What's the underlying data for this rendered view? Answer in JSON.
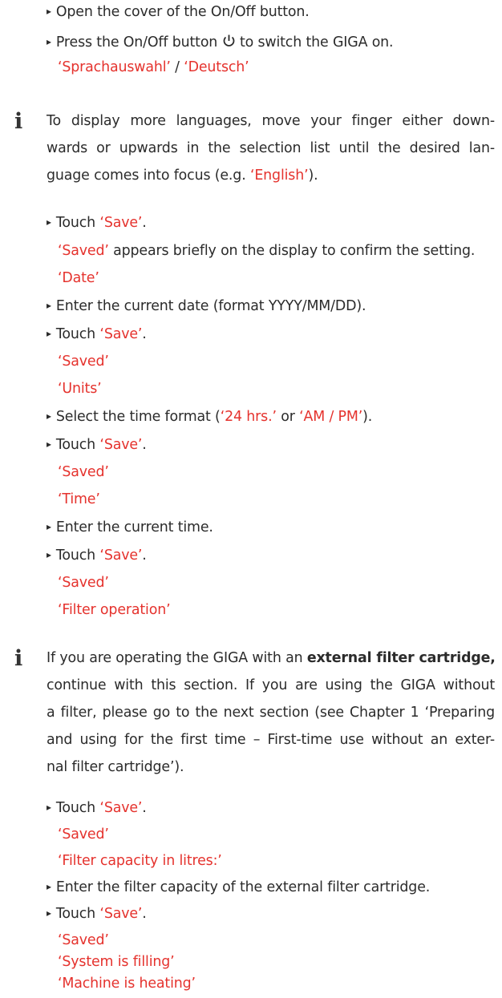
{
  "steps": [
    {
      "text": "Open the cover of the On/Off button."
    },
    {
      "pre": "Press the On/Off button ",
      "post": " to switch the GIGA on."
    },
    {
      "pre": "Touch ",
      "hl": "Save",
      "post": "."
    },
    {
      "text": "Enter the current date (format YYYY/MM/DD)."
    },
    {
      "pre": "Touch ",
      "hl": "Save",
      "post": "."
    },
    {
      "pre": "Select the time format (",
      "hl": "24 hrs.",
      "mid": " or ",
      "hl2": "AM / PM",
      "post": ")."
    },
    {
      "pre": "Touch ",
      "hl": "Save",
      "post": "."
    },
    {
      "text": "Enter the current time."
    },
    {
      "pre": "Touch ",
      "hl": "Save",
      "post": "."
    },
    {
      "pre": "Touch ",
      "hl": "Save",
      "post": "."
    },
    {
      "text": "Enter the filter capacity of the external filter cartridge."
    },
    {
      "pre": "Touch ",
      "hl": "Save",
      "post": "."
    }
  ],
  "display": {
    "lang_a": "Sprachauswahl",
    "sep": " / ",
    "lang_b": "Deutsch",
    "saved_confirm_hl": "Saved",
    "saved_confirm_rest": " appears briefly on the display to confirm the setting.",
    "date": "Date",
    "saved1": "Saved",
    "units": "Units",
    "saved2": "Saved",
    "time": "Time",
    "saved3": "Saved",
    "filter_op": "Filter operation",
    "saved4": "Saved",
    "filter_capacity": "Filter capacity in litres:",
    "saved5": "Saved",
    "system_filling": "System is filling",
    "machine_heating": "Machine is heating"
  },
  "note1": {
    "l1": "To display more languages, move your finger either down-",
    "l2": "wards or upwards in the selection list until the desired lan-",
    "l3_pre": "guage comes into focus (e.g. ",
    "l3_hl": "English",
    "l3_post": ")."
  },
  "note2": {
    "l1_pre": "If you are operating the GIGA with an ",
    "l1_bold": "external filter cartridge,",
    "l2": "continue with this section. If you are using the GIGA without",
    "l3": "a filter, please go to the next section (see Chapter 1 ‘Preparing",
    "l4": "and using for the first time – First-time use without an exter-",
    "l5": "nal filter cartridge’)."
  },
  "icons": {
    "bullet": "triangle-right-icon",
    "info": "info-icon",
    "power": "power-icon"
  },
  "colors": {
    "accent": "#e5322d",
    "text": "#2b2b2b"
  }
}
